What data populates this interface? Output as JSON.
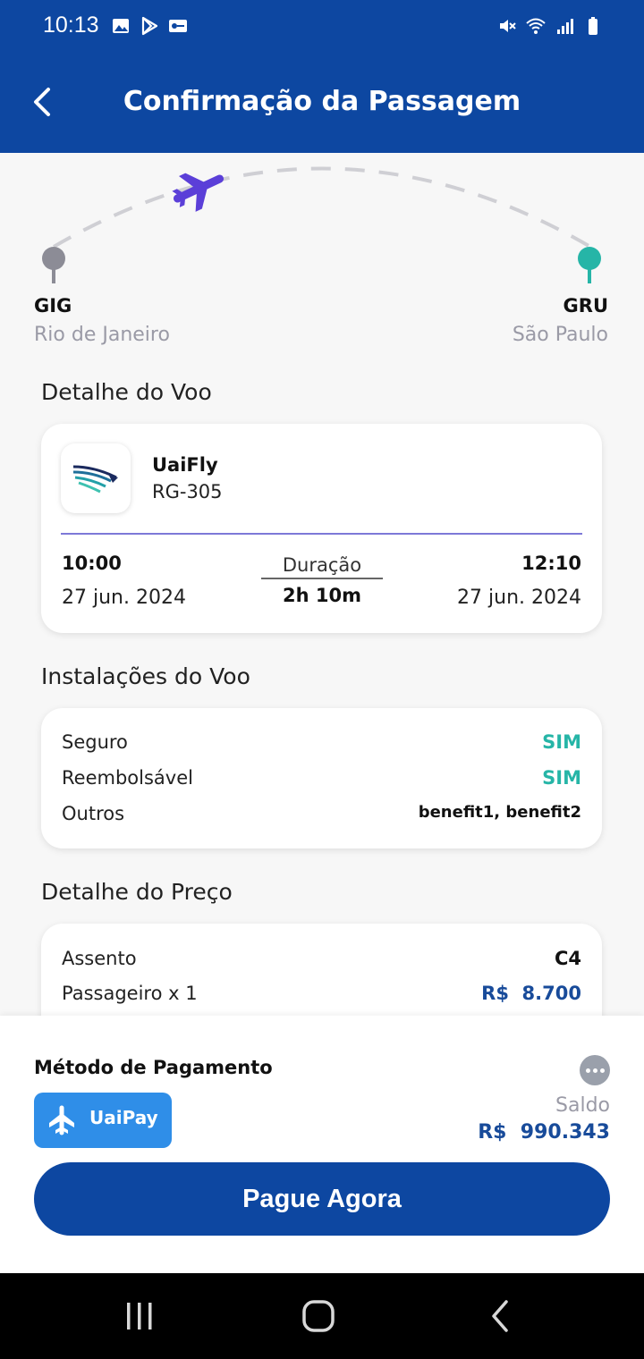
{
  "status_bar": {
    "time": "10:13",
    "left_icons": [
      "image-icon",
      "play-store-icon",
      "vpn-key-icon"
    ],
    "right_icons": [
      "mute-icon",
      "wifi-icon",
      "signal-icon",
      "battery-icon"
    ]
  },
  "header": {
    "title": "Confirmação da Passagem",
    "back_icon": "chevron-left-icon",
    "background": "#0d47a1"
  },
  "route": {
    "origin": {
      "code": "GIG",
      "city": "Rio de Janeiro"
    },
    "destination": {
      "code": "GRU",
      "city": "São Paulo"
    },
    "plane_icon": "airplane-icon",
    "plane_color": "#5b3fd8",
    "destination_color": "#26b5a7"
  },
  "flight_detail": {
    "section_title": "Detalhe do Voo",
    "airline": "UaiFly",
    "flight_code": "RG-305",
    "departure_time": "10:00",
    "departure_date": "27 jun. 2024",
    "duration_label": "Duração",
    "duration": "2h 10m",
    "arrival_time": "12:10",
    "arrival_date": "27 jun. 2024"
  },
  "facilities": {
    "section_title": "Instalações do Voo",
    "rows": [
      {
        "label": "Seguro",
        "value": "SIM"
      },
      {
        "label": "Reembolsável",
        "value": "SIM"
      },
      {
        "label": "Outros",
        "value": "benefit1, benefit2"
      }
    ]
  },
  "price_detail": {
    "section_title": "Detalhe do Preço",
    "rows": [
      {
        "label": "Assento",
        "value": "C4"
      },
      {
        "label": "Passageiro x 1",
        "value": "R$  8.700"
      }
    ]
  },
  "payment": {
    "title": "Método de Pagamento",
    "method_label": "UaiPay",
    "balance_label": "Saldo",
    "balance_value": "R$  990.343",
    "pay_button": "Pague Agora",
    "accent": "#2f8ee8"
  },
  "nav_bar": {
    "icons": [
      "recent-apps-icon",
      "home-icon",
      "back-icon"
    ]
  }
}
